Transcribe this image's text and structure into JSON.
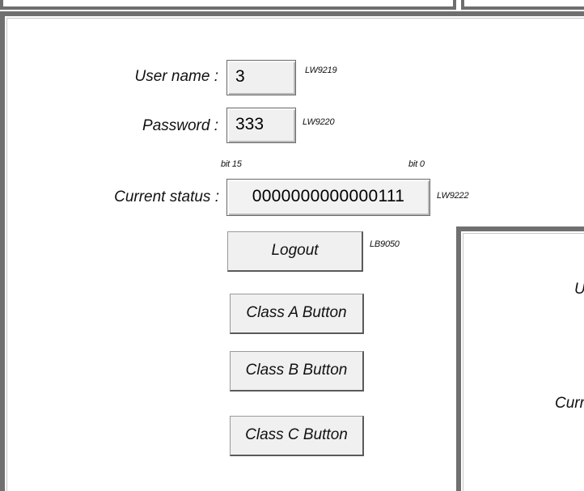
{
  "main": {
    "username_label": "User name :",
    "username_value": "3",
    "username_tag": "LW9219",
    "password_label": "Password :",
    "password_value": "333",
    "password_tag": "LW9220",
    "bit_high_label": "bit 15",
    "bit_low_label": "bit 0",
    "status_label": "Current status :",
    "status_value": "0000000000000111",
    "status_tag": "LW9222",
    "logout_label": "Logout",
    "logout_tag": "LB9050",
    "class_a_label": "Class A Button",
    "class_b_label": "Class B Button",
    "class_c_label": "Class C Button"
  },
  "secondary_window": {
    "fragment_1": "U",
    "fragment_2": "Curr"
  },
  "colors": {
    "frame": "#707070",
    "field_bg": "#f0f0f0",
    "page_bg": "#ffffff"
  }
}
